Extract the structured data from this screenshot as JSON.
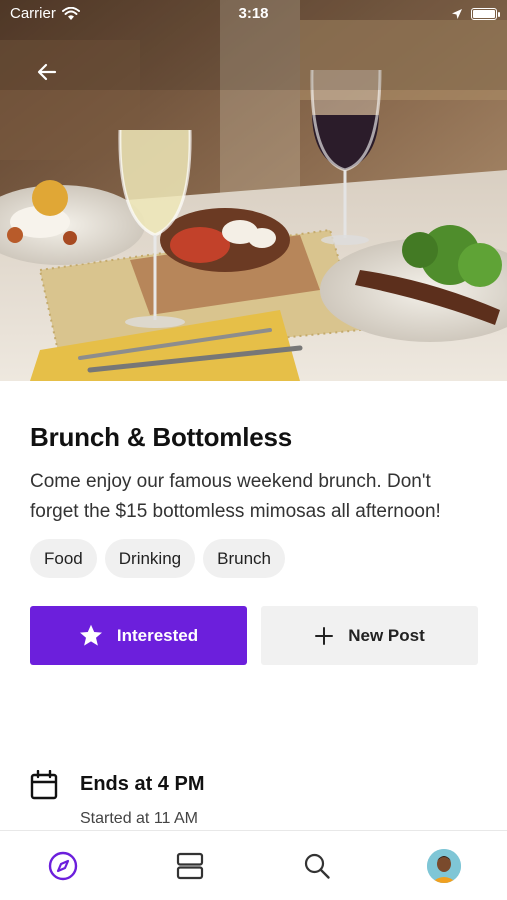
{
  "status_bar": {
    "carrier": "Carrier",
    "time": "3:18",
    "battery_level": 1.0
  },
  "header": {
    "back_icon": "arrow-left-icon"
  },
  "event": {
    "title": "Brunch & Bottomless",
    "description": "Come enjoy our famous weekend brunch. Don't forget the $15 bottomless mimosas all afternoon!",
    "tags": [
      "Food",
      "Drinking",
      "Brunch"
    ],
    "actions": {
      "interested_label": "Interested",
      "new_post_label": "New Post"
    },
    "schedule": {
      "title": "Ends at 4 PM",
      "subtitle": "Started at 11 AM"
    }
  },
  "tabbar": {
    "items": [
      {
        "icon": "compass-icon",
        "active": true
      },
      {
        "icon": "cards-icon",
        "active": false
      },
      {
        "icon": "search-icon",
        "active": false
      },
      {
        "icon": "avatar",
        "active": false
      }
    ]
  },
  "colors": {
    "accent": "#6c1fdc",
    "tag_bg": "#f0f0f0",
    "secondary_button_bg": "#f1f1f1"
  }
}
